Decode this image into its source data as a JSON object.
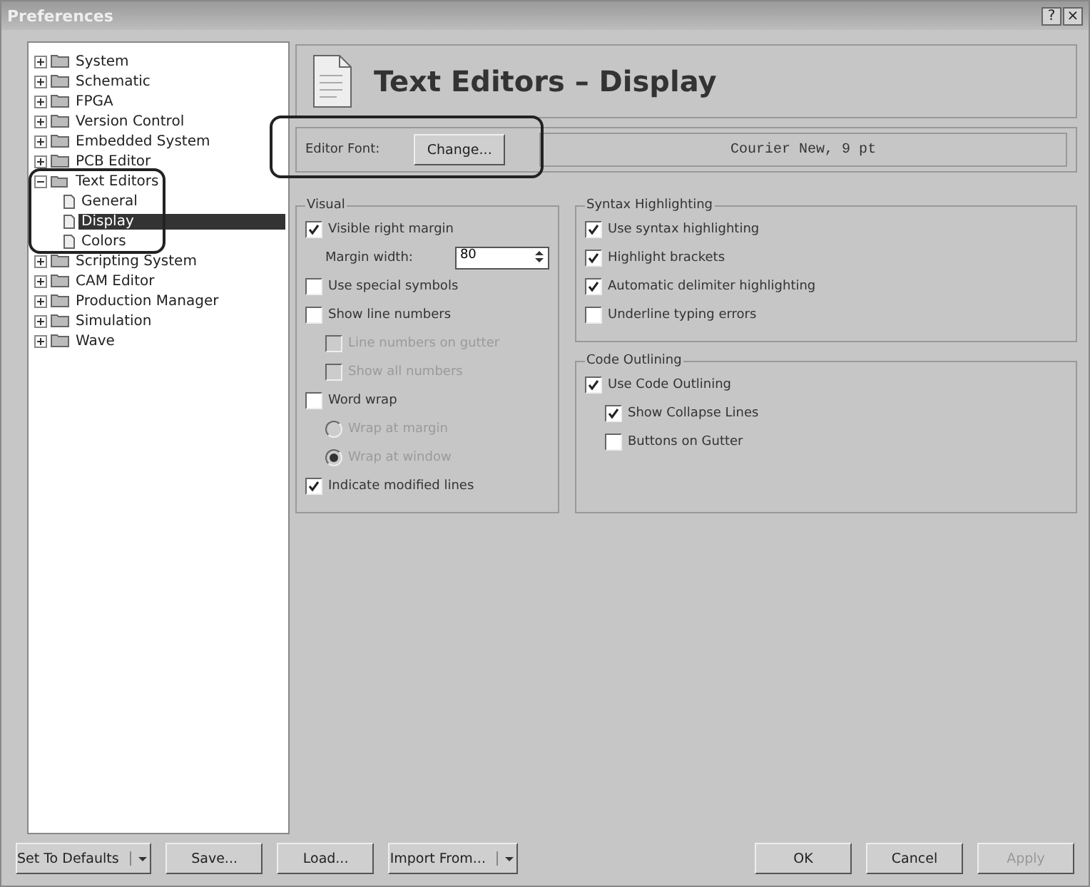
{
  "window": {
    "title": "Preferences",
    "buttons": [
      "?",
      "×"
    ]
  },
  "tree": [
    {
      "label": "System",
      "expanded": false,
      "selected": false
    },
    {
      "label": "Schematic",
      "expanded": false,
      "selected": false
    },
    {
      "label": "FPGA",
      "expanded": false,
      "selected": false
    },
    {
      "label": "Version Control",
      "expanded": false,
      "selected": false
    },
    {
      "label": "Embedded System",
      "expanded": false,
      "selected": false
    },
    {
      "label": "PCB Editor",
      "expanded": false,
      "selected": false
    },
    {
      "label": "Text Editors",
      "expanded": true,
      "selected": false,
      "children": [
        {
          "label": "General",
          "selected": false
        },
        {
          "label": "Display",
          "selected": true
        },
        {
          "label": "Colors",
          "selected": false
        }
      ]
    },
    {
      "label": "Scripting System",
      "expanded": false,
      "selected": false
    },
    {
      "label": "CAM Editor",
      "expanded": false,
      "selected": false
    },
    {
      "label": "Production Manager",
      "expanded": false,
      "selected": false
    },
    {
      "label": "Simulation",
      "expanded": false,
      "selected": false
    },
    {
      "label": "Wave",
      "expanded": false,
      "selected": false
    }
  ],
  "page_title": "Text Editors – Display",
  "editor_font": {
    "label": "Editor Font:",
    "button": "Change...",
    "value": "Courier New, 9 pt"
  },
  "groups": [
    {
      "title": "Visual",
      "options": [
        {
          "kind": "checkbox",
          "label": "Visible right margin",
          "checked": true,
          "disabled": false,
          "children": [
            {
              "kind": "spin",
              "label": "Margin width:",
              "value": "80",
              "disabled": false
            }
          ]
        },
        {
          "kind": "checkbox",
          "label": "Use special symbols",
          "checked": false,
          "disabled": false
        },
        {
          "kind": "checkbox",
          "label": "Show line numbers",
          "checked": false,
          "disabled": false,
          "children": [
            {
              "kind": "checkbox",
              "label": "Line numbers on gutter",
              "checked": false,
              "disabled": true
            },
            {
              "kind": "checkbox",
              "label": "Show all numbers",
              "checked": false,
              "disabled": true
            }
          ]
        },
        {
          "kind": "checkbox",
          "label": "Word wrap",
          "checked": false,
          "disabled": false,
          "children": [
            {
              "kind": "radio",
              "label": "Wrap at margin",
              "selected": false,
              "disabled": true
            },
            {
              "kind": "radio",
              "label": "Wrap at window",
              "selected": true,
              "disabled": true
            }
          ]
        },
        {
          "kind": "checkbox",
          "label": "Indicate modified lines",
          "checked": true,
          "disabled": false
        }
      ]
    },
    {
      "title": "Syntax Highlighting",
      "options": [
        {
          "kind": "checkbox",
          "label": "Use syntax highlighting",
          "checked": true,
          "disabled": false
        },
        {
          "kind": "checkbox",
          "label": "Highlight brackets",
          "checked": true,
          "disabled": false
        },
        {
          "kind": "checkbox",
          "label": "Automatic delimiter highlighting",
          "checked": true,
          "disabled": false
        },
        {
          "kind": "checkbox",
          "label": "Underline typing errors",
          "checked": false,
          "disabled": false
        }
      ]
    },
    {
      "title": "Code Outlining",
      "options": [
        {
          "kind": "checkbox",
          "label": "Use Code Outlining",
          "checked": true,
          "disabled": false,
          "children": [
            {
              "kind": "checkbox",
              "label": "Show Collapse Lines",
              "checked": true,
              "disabled": false
            },
            {
              "kind": "checkbox",
              "label": "Buttons on Gutter",
              "checked": false,
              "disabled": false
            }
          ]
        }
      ]
    }
  ],
  "footer_left": [
    {
      "label": "Set To Defaults",
      "kind": "split",
      "disabled": false
    },
    {
      "label": "Save...",
      "kind": "plain",
      "disabled": false
    },
    {
      "label": "Load...",
      "kind": "plain",
      "disabled": false
    },
    {
      "label": "Import From...",
      "kind": "split",
      "disabled": false
    }
  ],
  "footer_right": [
    {
      "label": "OK",
      "disabled": false
    },
    {
      "label": "Cancel",
      "disabled": false
    },
    {
      "label": "Apply",
      "disabled": true
    }
  ]
}
